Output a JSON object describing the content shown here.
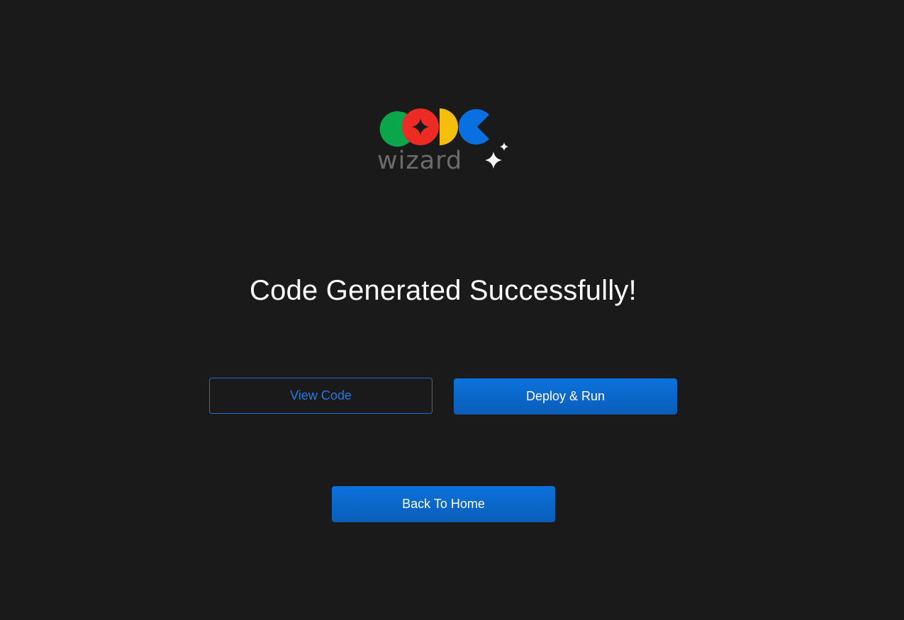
{
  "logo": {
    "wordmark": "wizard",
    "top_text": "CODE",
    "colors": {
      "green": "#0aa64a",
      "red": "#ee2a24",
      "yellow": "#f5bd0c",
      "blue": "#0a6fe0",
      "wordmark": "#6b6b6b",
      "sparkle": "#ffffff"
    },
    "icons": [
      "sparkle-icon"
    ]
  },
  "page": {
    "title": "Code Generated Successfully!"
  },
  "actions": {
    "view_code_label": "View Code",
    "deploy_label": "Deploy & Run",
    "home_label": "Back To Home"
  },
  "theme": {
    "background": "#1a1a1a",
    "accent": "#0b6bd4",
    "text": "#ffffff"
  }
}
